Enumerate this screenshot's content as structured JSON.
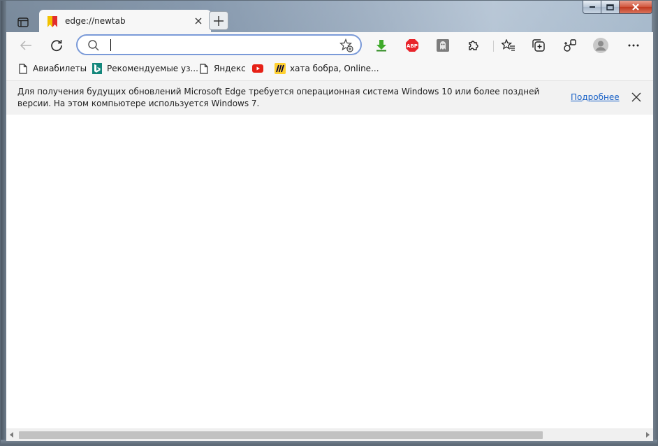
{
  "window": {
    "caption_buttons": [
      "minimize",
      "maximize",
      "close"
    ]
  },
  "tabs": {
    "active_title": "edge://newtab",
    "new_tab_label": "+"
  },
  "toolbar": {
    "address_value": "",
    "address_placeholder": "",
    "extensions": [
      "download-extension-icon",
      "adblock-plus-icon",
      "ghost-extension-icon",
      "extensions-puzzle-icon"
    ],
    "more_label": "···"
  },
  "favorites": [
    {
      "label": "Авиабилеты",
      "icon": "page-icon"
    },
    {
      "label": "Рекомендуемые уз...",
      "icon": "bing-icon"
    },
    {
      "label": "Яндекс",
      "icon": "page-icon"
    },
    {
      "label": "",
      "icon": "youtube-icon"
    },
    {
      "label": "хата бобра, Online...",
      "icon": "miro-icon"
    }
  ],
  "infobar": {
    "message": "Для получения будущих обновлений Microsoft Edge требуется операционная система Windows 10 или более поздней версии. На этом компьютере используется Windows 7.",
    "link_label": "Подробнее"
  },
  "colors": {
    "accent": "#7a9ad8",
    "link": "#1a62c7",
    "chrome_bg": "#f7f7f7",
    "close_button": "#c0391f"
  }
}
